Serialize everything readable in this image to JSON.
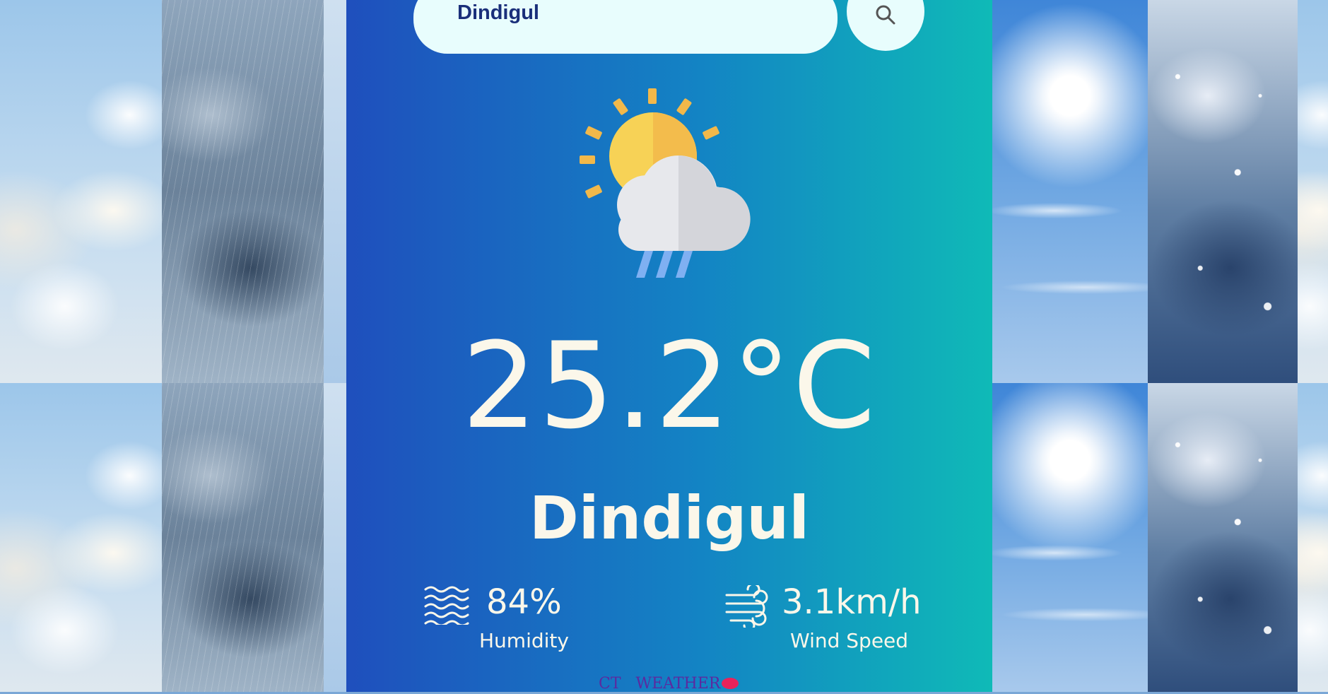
{
  "search": {
    "value": "Dindigul",
    "button_icon": "search-icon"
  },
  "weather": {
    "icon": "sun-cloud-rain-icon",
    "temperature": "25.2°C",
    "city": "Dindigul",
    "humidity": {
      "icon": "waves-icon",
      "value": "84%",
      "label": "Humidity"
    },
    "wind": {
      "icon": "wind-icon",
      "value": "3.1km/h",
      "label": "Wind Speed"
    }
  },
  "footer": {
    "text": "CT   WEATHER"
  },
  "colors": {
    "card_gradient_start": "#1f4fbd",
    "card_gradient_end": "#0fbab7",
    "text": "#fbf7ea",
    "search_bg": "#e8fdfd",
    "search_text": "#1a2f7a"
  }
}
